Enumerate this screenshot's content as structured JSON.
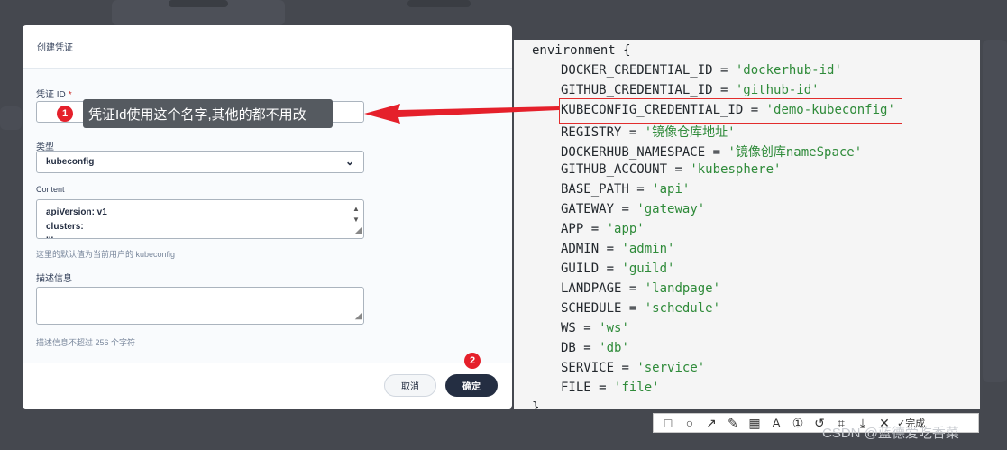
{
  "dialog": {
    "title": "创建凭证",
    "credential_id_label": "凭证 ID",
    "required_mark": "*",
    "credential_id_value": "",
    "type_label": "类型",
    "type_value": "kubeconfig",
    "content_label": "Content",
    "content_lines": [
      "apiVersion: v1",
      "clusters:",
      "  ..."
    ],
    "content_hint": "这里的默认值为当前用户的 kubeconfig",
    "description_label": "描述信息",
    "description_value": "",
    "description_hint": "描述信息不超过 256 个字符",
    "cancel_label": "取消",
    "ok_label": "确定"
  },
  "annotations": {
    "badge_1": "1",
    "badge_2": "2",
    "tooltip": "凭证Id使用这个名字,其他的都不用改",
    "accent_color": "#e5202b"
  },
  "code": {
    "header": "environment {",
    "entries": [
      {
        "key": "DOCKER_CREDENTIAL_ID",
        "value": "'dockerhub-id'"
      },
      {
        "key": "GITHUB_CREDENTIAL_ID",
        "value": "'github-id'"
      },
      {
        "key": "KUBECONFIG_CREDENTIAL_ID",
        "value": "'demo-kubeconfig'"
      },
      {
        "key": "REGISTRY",
        "value": "'镜像仓库地址'"
      },
      {
        "key": "DOCKERHUB_NAMESPACE",
        "value": "'镜像创库nameSpace'"
      },
      {
        "key": "GITHUB_ACCOUNT",
        "value": "'kubesphere'"
      },
      {
        "key": "BASE_PATH",
        "value": "'api'"
      },
      {
        "key": "GATEWAY",
        "value": "'gateway'"
      },
      {
        "key": "APP",
        "value": "'app'"
      },
      {
        "key": "ADMIN",
        "value": "'admin'"
      },
      {
        "key": "GUILD",
        "value": "'guild'"
      },
      {
        "key": "LANDPAGE",
        "value": "'landpage'"
      },
      {
        "key": "SCHEDULE",
        "value": "'schedule'"
      },
      {
        "key": "WS",
        "value": "'ws'"
      },
      {
        "key": "DB",
        "value": "'db'"
      },
      {
        "key": "SERVICE",
        "value": "'service'"
      },
      {
        "key": "FILE",
        "value": "'file'"
      }
    ],
    "footer": "}"
  },
  "toolbar": {
    "tools": [
      "rectangle-tool",
      "ellipse-tool",
      "arrow-tool",
      "pen-tool",
      "mosaic-tool",
      "text-tool",
      "number-tool",
      "undo-tool",
      "crop-tool",
      "download-tool",
      "close-tool"
    ],
    "done_label": "完成"
  },
  "watermark": "CSDN @蓝德爱吃香菜"
}
